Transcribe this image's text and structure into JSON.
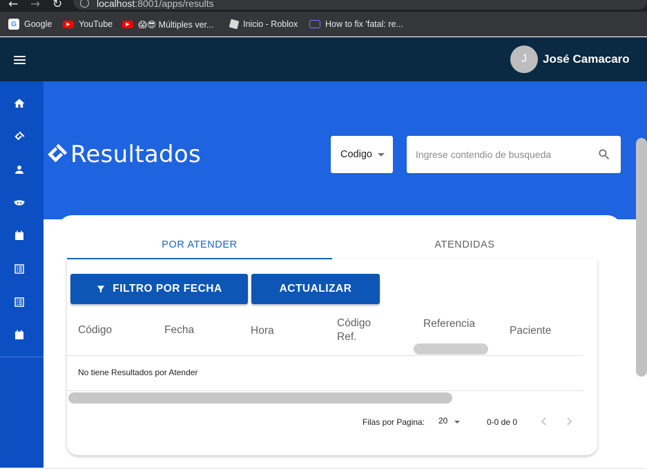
{
  "browser": {
    "url_host": "localhost",
    "url_rest": ":8001/apps/results",
    "bookmarks": [
      {
        "label": "Google",
        "icon": "google-favicon"
      },
      {
        "label": "YouTube",
        "icon": "youtube-favicon"
      },
      {
        "label": "😱😎 Múltiples ver...",
        "icon": "youtube-favicon"
      },
      {
        "label": "Inicio - Roblox",
        "icon": "roblox-favicon"
      },
      {
        "label": "How to fix 'fatal: re...",
        "icon": "github-favicon"
      }
    ]
  },
  "header": {
    "avatar_initial": "J",
    "user_name": "José Camacaro"
  },
  "sidebar": {
    "icons": [
      "home-icon",
      "handshake-icon",
      "person-icon",
      "mask-icon",
      "calendar-icon",
      "list-icon",
      "list-icon",
      "calendar-icon"
    ]
  },
  "hero": {
    "title": "Resultados",
    "filter_select_value": "Codigo",
    "search_placeholder": "Ingrese contendio de busqueda"
  },
  "tabs": [
    "POR ATENDER",
    "ATENDIDAS"
  ],
  "actions": {
    "filter_label": "FILTRO POR FECHA",
    "refresh_label": "ACTUALIZAR"
  },
  "table": {
    "columns": [
      "Código",
      "Fecha",
      "Hora",
      "Código Ref.",
      "Referencia",
      "Paciente"
    ],
    "empty_message": "No tiene Resultados por Atender"
  },
  "pagination": {
    "rows_label": "Filas por Pagina:",
    "rows_value": "20",
    "range": "0-0 de 0"
  },
  "colors": {
    "header_bg": "#0a2942",
    "sidebar_bg": "#0b4fc2",
    "hero_bg": "#1e63df",
    "button_bg": "#0d56b6",
    "tab_active": "#1565c0"
  }
}
